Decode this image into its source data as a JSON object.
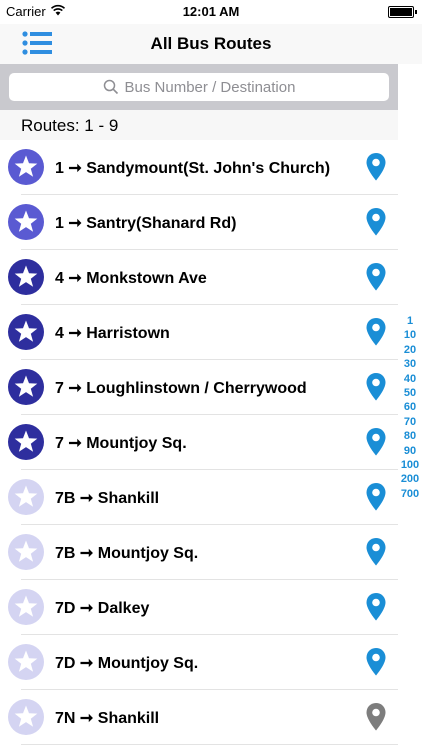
{
  "status_bar": {
    "carrier": "Carrier",
    "time": "12:01 AM"
  },
  "nav": {
    "title": "All Bus Routes",
    "menu_icon": "list-icon"
  },
  "search": {
    "placeholder": "Bus Number / Destination",
    "value": ""
  },
  "section": {
    "header": "Routes: 1 - 9"
  },
  "routes": [
    {
      "number": "1",
      "destination": "Sandymount(St. John's Church)",
      "favorite_color": "#5a5ad2",
      "pin_color": "#1a8ed6"
    },
    {
      "number": "1",
      "destination": "Santry(Shanard Rd)",
      "favorite_color": "#5a5ad2",
      "pin_color": "#1a8ed6"
    },
    {
      "number": "4",
      "destination": "Monkstown Ave",
      "favorite_color": "#2e2e9e",
      "pin_color": "#1a8ed6"
    },
    {
      "number": "4",
      "destination": "Harristown",
      "favorite_color": "#2e2e9e",
      "pin_color": "#1a8ed6"
    },
    {
      "number": "7",
      "destination": "Loughlinstown / Cherrywood",
      "favorite_color": "#2e2e9e",
      "pin_color": "#1a8ed6"
    },
    {
      "number": "7",
      "destination": "Mountjoy Sq.",
      "favorite_color": "#2e2e9e",
      "pin_color": "#1a8ed6"
    },
    {
      "number": "7B",
      "destination": "Shankill",
      "favorite_color": "#d4d4f2",
      "pin_color": "#1a8ed6"
    },
    {
      "number": "7B",
      "destination": "Mountjoy Sq.",
      "favorite_color": "#d4d4f2",
      "pin_color": "#1a8ed6"
    },
    {
      "number": "7D",
      "destination": "Dalkey",
      "favorite_color": "#d4d4f2",
      "pin_color": "#1a8ed6"
    },
    {
      "number": "7D",
      "destination": "Mountjoy Sq.",
      "favorite_color": "#d4d4f2",
      "pin_color": "#1a8ed6"
    },
    {
      "number": "7N",
      "destination": "Shankill",
      "favorite_color": "#d4d4f2",
      "pin_color": "#7d7d7d"
    }
  ],
  "arrow": "➞",
  "index": [
    "1",
    "10",
    "20",
    "30",
    "40",
    "50",
    "60",
    "70",
    "80",
    "90",
    "100",
    "200",
    "700"
  ],
  "colors": {
    "accent": "#1a8ed6",
    "nav_icon": "#2f8ee0"
  }
}
